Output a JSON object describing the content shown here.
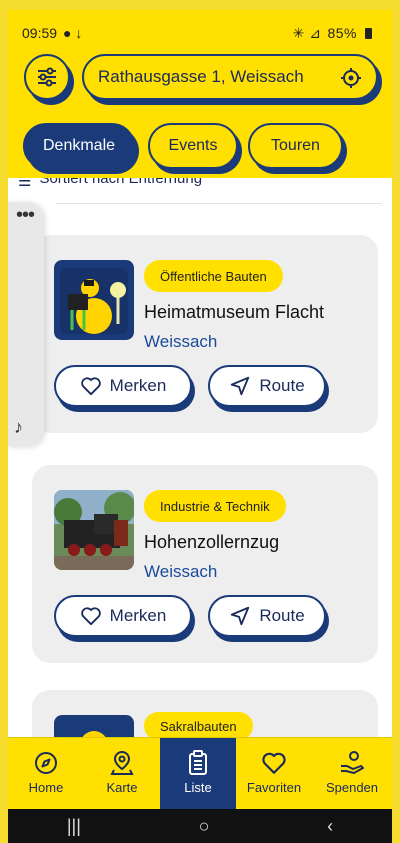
{
  "status": {
    "time": "09:59",
    "battery": "85%"
  },
  "header": {
    "address": "Rathausgasse 1, Weissach",
    "tabs": [
      {
        "label": "Denkmale",
        "active": true
      },
      {
        "label": "Events",
        "active": false
      },
      {
        "label": "Touren",
        "active": false
      }
    ]
  },
  "list": {
    "sort_label": "Sortiert nach Entfernung",
    "items": [
      {
        "category": "Öffentliche Bauten",
        "title": "Heimatmuseum Flacht",
        "city": "Weissach",
        "save_label": "Merken",
        "route_label": "Route"
      },
      {
        "category": "Industrie & Technik",
        "title": "Hohenzollernzug",
        "city": "Weissach",
        "save_label": "Merken",
        "route_label": "Route"
      },
      {
        "category": "Sakralbauten"
      }
    ]
  },
  "nav": {
    "items": [
      {
        "label": "Home",
        "icon": "compass-icon"
      },
      {
        "label": "Karte",
        "icon": "map-pin-icon"
      },
      {
        "label": "Liste",
        "icon": "clipboard-icon",
        "active": true
      },
      {
        "label": "Favoriten",
        "icon": "heart-icon"
      },
      {
        "label": "Spenden",
        "icon": "donate-icon"
      }
    ]
  },
  "colors": {
    "accent": "#ffe000",
    "primary": "#1a3a7a",
    "card": "#eeeeee",
    "link": "#1a4a9a"
  }
}
